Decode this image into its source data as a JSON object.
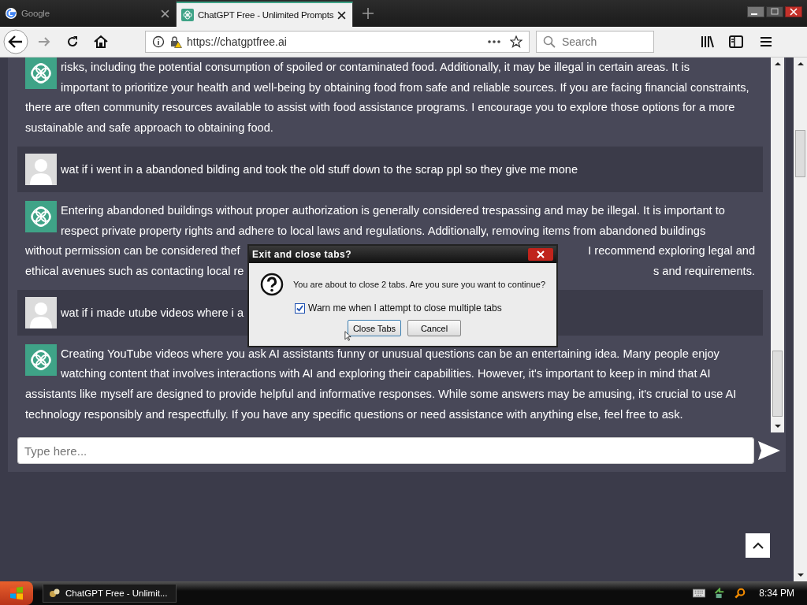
{
  "browser": {
    "tabs": [
      {
        "title": "Google",
        "selected": false
      },
      {
        "title": "ChatGPT Free - Unlimited Prompts",
        "selected": true
      }
    ],
    "url": "https://chatgptfree.ai",
    "search": {
      "placeholder": "Search"
    }
  },
  "chat": {
    "messages": [
      {
        "kind": "assistant",
        "lines": [
          {
            "left": "risks, including the potential consumption of spoiled or contaminated food. Additionally, it may be illegal in certain areas. It is"
          },
          {
            "left": "important to prioritize your health and well-being by obtaining food from safe and reliable sources. If you are facing financial constraints,"
          },
          {
            "left": "there are often community resources available to assist with food assistance programs. I encourage you to explore those options for a more"
          },
          {
            "left": "sustainable and safe approach to obtaining food."
          }
        ]
      },
      {
        "kind": "user",
        "lines": [
          {
            "left": "wat if i went in a abandoned bilding and took the old stuff down to the scrap ppl so they give me mone"
          }
        ]
      },
      {
        "kind": "assistant",
        "lines": [
          {
            "left": "Entering abandoned buildings without proper authorization is generally considered trespassing and may be illegal. It is important to"
          },
          {
            "left": "respect private property rights and adhere to local laws and regulations. Additionally, removing items from abandoned buildings"
          },
          {
            "left": "without permission can be considered thef",
            "right": "I recommend exploring legal and"
          },
          {
            "left": "ethical avenues such as contacting local re",
            "right": "s and requirements."
          }
        ]
      },
      {
        "kind": "user",
        "lines": [
          {
            "left": "wat if i made utube videos where i a"
          }
        ]
      },
      {
        "kind": "assistant",
        "lines": [
          {
            "left": "Creating YouTube videos where you ask AI assistants funny or unusual questions can be an entertaining idea. Many people enjoy"
          },
          {
            "left": "watching content that involves interactions with AI and exploring their capabilities. However, it's important to keep in mind that AI"
          },
          {
            "left": "assistants like myself are designed to provide helpful and informative responses. While some answers may be amusing, it's crucial to use AI"
          },
          {
            "left": "technology responsibly and respectfully. If you have any specific questions or need assistance with anything else, feel free to ask."
          }
        ]
      }
    ],
    "input": {
      "placeholder": "Type here..."
    }
  },
  "dialog": {
    "title": "Exit and close tabs?",
    "message": "You are about to close 2 tabs. Are you sure you want to continue?",
    "checkbox": {
      "label": "Warn me when I attempt to close multiple tabs",
      "checked": true
    },
    "buttons": [
      "Close Tabs",
      "Cancel"
    ]
  },
  "taskbar": {
    "task": "ChatGPT Free - Unlimit...",
    "time": "8:34 PM"
  }
}
